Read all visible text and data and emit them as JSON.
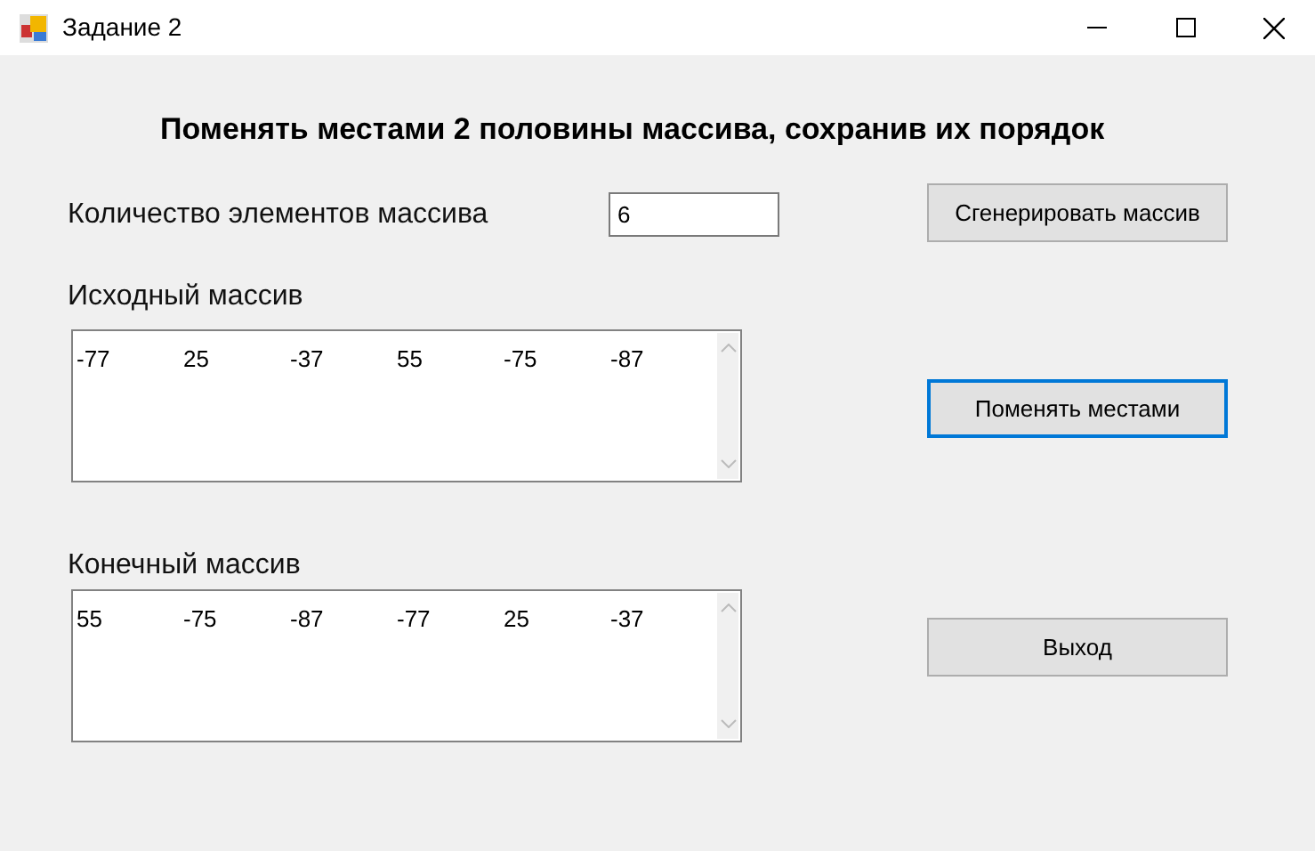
{
  "window": {
    "title": "Задание 2"
  },
  "heading": "Поменять местами 2 половины массива, сохранив их порядок",
  "count": {
    "label": "Количество элементов массива",
    "value": "6"
  },
  "source": {
    "label": "Исходный массив",
    "values": [
      "-77",
      "25",
      "-37",
      "55",
      "-75",
      "-87"
    ]
  },
  "result": {
    "label": "Конечный массив",
    "values": [
      "55",
      "-75",
      "-87",
      "-77",
      "25",
      "-37"
    ]
  },
  "buttons": [
    {
      "label": "Сгенерировать массив",
      "focused": false
    },
    {
      "label": "Поменять местами",
      "focused": true
    },
    {
      "label": "Выход",
      "focused": false
    }
  ]
}
